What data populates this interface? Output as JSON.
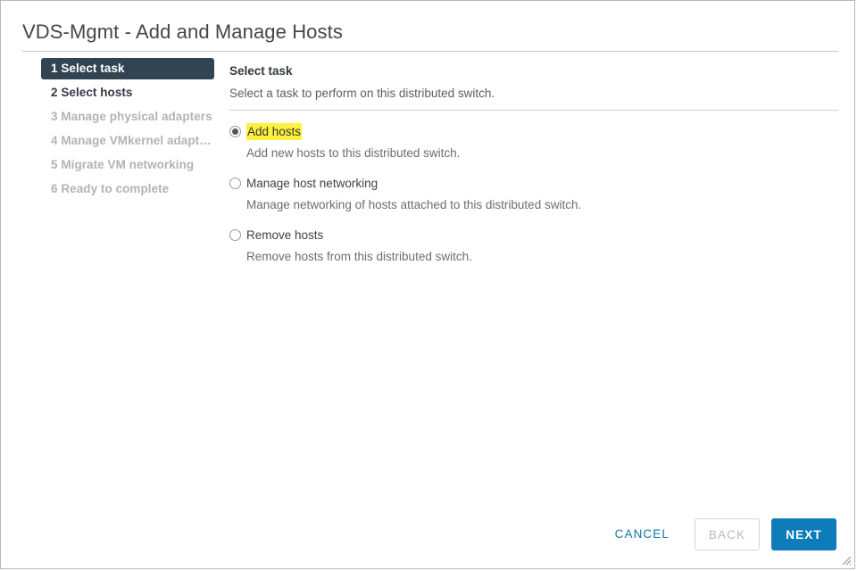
{
  "window": {
    "title": "VDS-Mgmt - Add and Manage Hosts"
  },
  "sidebar": {
    "steps": [
      {
        "label": "1 Select task",
        "state": "active"
      },
      {
        "label": "2 Select hosts",
        "state": "enabled"
      },
      {
        "label": "3 Manage physical adapters",
        "state": "disabled"
      },
      {
        "label": "4 Manage VMkernel adapt…",
        "state": "disabled"
      },
      {
        "label": "5 Migrate VM networking",
        "state": "disabled"
      },
      {
        "label": "6 Ready to complete",
        "state": "disabled"
      }
    ]
  },
  "main": {
    "pane_title": "Select task",
    "pane_subtitle": "Select a task to perform on this distributed switch.",
    "options": [
      {
        "label": "Add hosts",
        "description": "Add new hosts to this distributed switch.",
        "selected": true,
        "highlighted": true
      },
      {
        "label": "Manage host networking",
        "description": "Manage networking of hosts attached to this distributed switch.",
        "selected": false,
        "highlighted": false
      },
      {
        "label": "Remove hosts",
        "description": "Remove hosts from this distributed switch.",
        "selected": false,
        "highlighted": false
      }
    ]
  },
  "footer": {
    "cancel_label": "CANCEL",
    "back_label": "BACK",
    "next_label": "NEXT"
  },
  "colors": {
    "active_step_bg": "#314453",
    "primary_button_bg": "#0f7cba",
    "link_blue": "#1175a8",
    "highlight_yellow": "#fff23f",
    "disabled_text": "#b3b3b3"
  }
}
